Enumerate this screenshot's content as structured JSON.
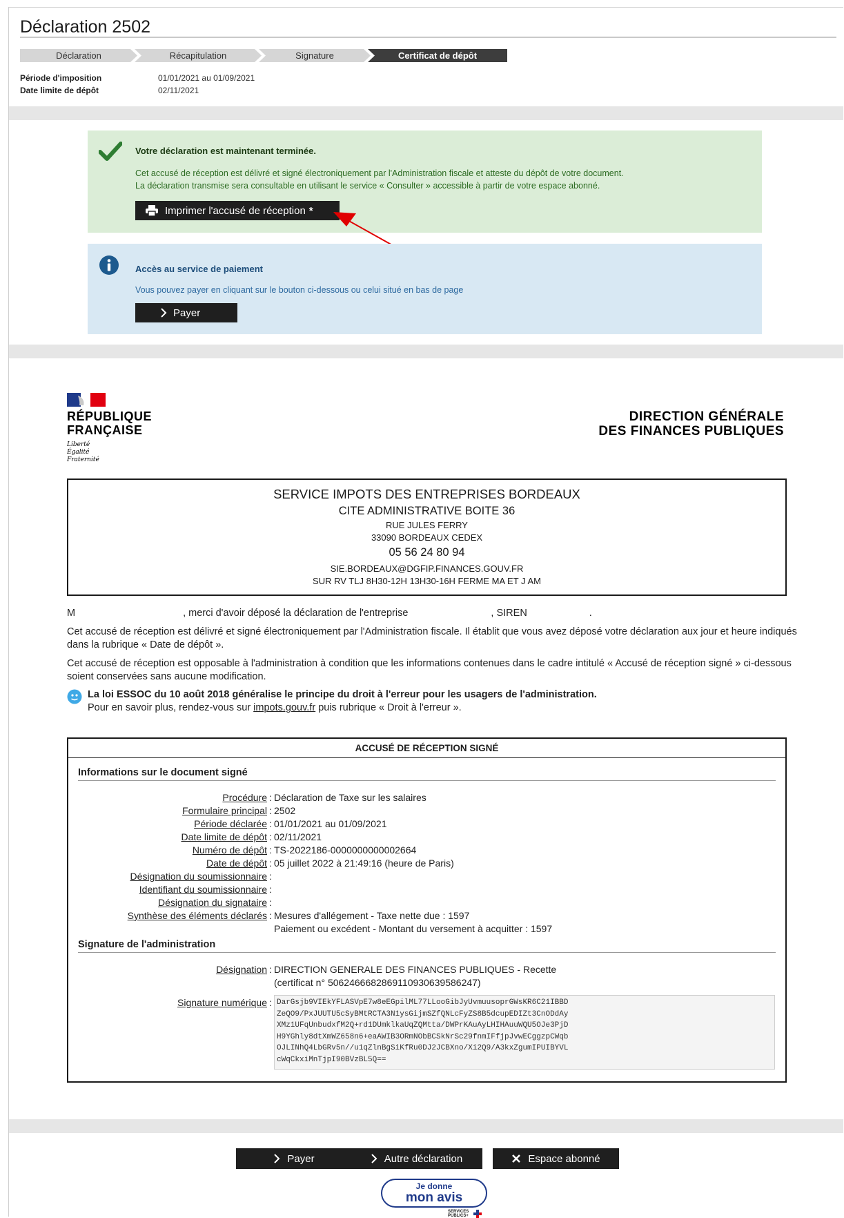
{
  "header": {
    "title": "Déclaration 2502",
    "steps": [
      "Déclaration",
      "Récapitulation",
      "Signature",
      "Certificat de dépôt"
    ],
    "periode_label": "Période d'imposition",
    "periode_value": "01/01/2021 au 01/09/2021",
    "date_limite_label": "Date limite de dépôt",
    "date_limite_value": "02/11/2021"
  },
  "success_box": {
    "heading": "Votre déclaration est maintenant terminée.",
    "line1": "Cet accusé de réception est délivré et signé électroniquement par l'Administration fiscale et atteste du dépôt de votre document.",
    "line2": "La déclaration transmise sera consultable en utilisant le service « Consulter » accessible à partir de votre espace abonné.",
    "print_button": "Imprimer l'accusé de réception",
    "print_marker": "*"
  },
  "payment_box": {
    "heading": "Accès au service de paiement",
    "text": "Vous pouvez payer en cliquant sur le bouton ci-dessous ou celui situé en bas de page",
    "pay_button": "Payer"
  },
  "logo": {
    "republique": "RÉPUBLIQUE",
    "francaise": "FRANÇAISE",
    "motto": [
      "Liberté",
      "Égalité",
      "Fraternité"
    ],
    "dgfip_line1": "DIRECTION GÉNÉRALE",
    "dgfip_line2": "DES FINANCES PUBLIQUES"
  },
  "service": {
    "name": "SERVICE IMPOTS DES ENTREPRISES BORDEAUX",
    "cite": "CITE ADMINISTRATIVE BOITE 36",
    "rue": "RUE JULES FERRY",
    "ville": "33090 BORDEAUX CEDEX",
    "tel": "05 56 24 80 94",
    "email": "SIE.BORDEAUX@DGFIP.FINANCES.GOUV.FR",
    "horaires": "SUR RV TLJ 8H30-12H 13H30-16H FERME MA ET J AM"
  },
  "body": {
    "thanks_m": "M",
    "thanks_mid": ", merci d'avoir déposé la déclaration de l'entreprise",
    "thanks_siren": ", SIREN",
    "thanks_end": ".",
    "p1": "Cet accusé de réception est délivré et signé électroniquement par l'Administration fiscale. Il établit que vous avez déposé votre déclaration aux jour et heure indiqués dans la rubrique « Date de dépôt ».",
    "p2": "Cet accusé de réception est opposable à l'administration à condition que les informations contenues dans le cadre intitulé « Accusé de réception signé » ci-dessous soient conservées sans aucune modification.",
    "essoc_bold": "La loi ESSOC du 10 août 2018 généralise le principe du droit à l'erreur pour les usagers de l'administration.",
    "essoc_pre": "Pour en savoir plus, rendez-vous sur ",
    "essoc_link": "impots.gouv.fr",
    "essoc_post": " puis rubrique « Droit à l'erreur »."
  },
  "ack": {
    "title": "ACCUSÉ DE RÉCEPTION SIGNÉ",
    "section1": "Informations sur le document signé",
    "rows": [
      {
        "k": "Procédure",
        "v": "Déclaration de Taxe sur les salaires"
      },
      {
        "k": "Formulaire principal",
        "v": "2502"
      },
      {
        "k": "Période déclarée",
        "v": "01/01/2021 au 01/09/2021"
      },
      {
        "k": "Date limite de dépôt",
        "v": "02/11/2021"
      },
      {
        "k": "Numéro de dépôt",
        "v": "TS-2022186-0000000000002664"
      },
      {
        "k": "Date de dépôt",
        "v": "05 juillet 2022 à 21:49:16 (heure de Paris)"
      },
      {
        "k": "Désignation du soumissionnaire",
        "v": ""
      },
      {
        "k": "Identifiant du soumissionnaire",
        "v": ""
      },
      {
        "k": "Désignation du signataire",
        "v": ""
      },
      {
        "k": "Synthèse des éléments déclarés",
        "v": "Mesures d'allégement - Taxe nette due : 1597"
      }
    ],
    "synthese_line2": "Paiement ou excédent - Montant du versement à acquitter : 1597",
    "section2": "Signature de l'administration",
    "designation_label": "Désignation",
    "designation_value": "DIRECTION GENERALE DES FINANCES PUBLIQUES - Recette",
    "certificat": "(certificat n° 506246668286911093063958624​7)",
    "signature_label": "Signature numérique",
    "signature_lines": [
      "DarGsjb9VIEkYFLASVpE7w8eEGpilML77LLooGibJyUvmuusoprGWsKR6C21IBBD",
      "ZeQO9/PxJUUTU5cSyBMtRCTA3N1ysGijmSZfQNLcFyZS8B5dcupEDIZt3CnODdAy",
      "XMz1UFqUnbudxfM2Q+rd1DUmklkaUqZQMtta/DWPrKAuAyLHIHAuuWQU5OJe3PjD",
      "H9YGhly8dtXmWZ658n6+eaAWIB3ORmNObBCSkNrSc29fnmIFfjpJvwECggzpCWqb",
      "OJLINhQ4LbGRv5n//u1qZlnBgSiKfRu0DJ2JCBXno/Xi2Q9/A3kxZgumIPUIBYVL",
      "cWqCkxiMnTjpI90BVzBL5Q=="
    ]
  },
  "footer": {
    "pay": "Payer",
    "autre": "Autre déclaration",
    "espace": "Espace abonné",
    "avis_l1": "Je donne",
    "avis_l2": "mon avis",
    "sp_l1": "SERVICES",
    "sp_l2": "PUBLICS+"
  },
  "colors": {
    "success_bg": "#dbedd7",
    "info_bg": "#d8e8f3",
    "check_green": "#2e7d32",
    "info_blue": "#1d5a8e",
    "arrow_red": "#e00000"
  }
}
